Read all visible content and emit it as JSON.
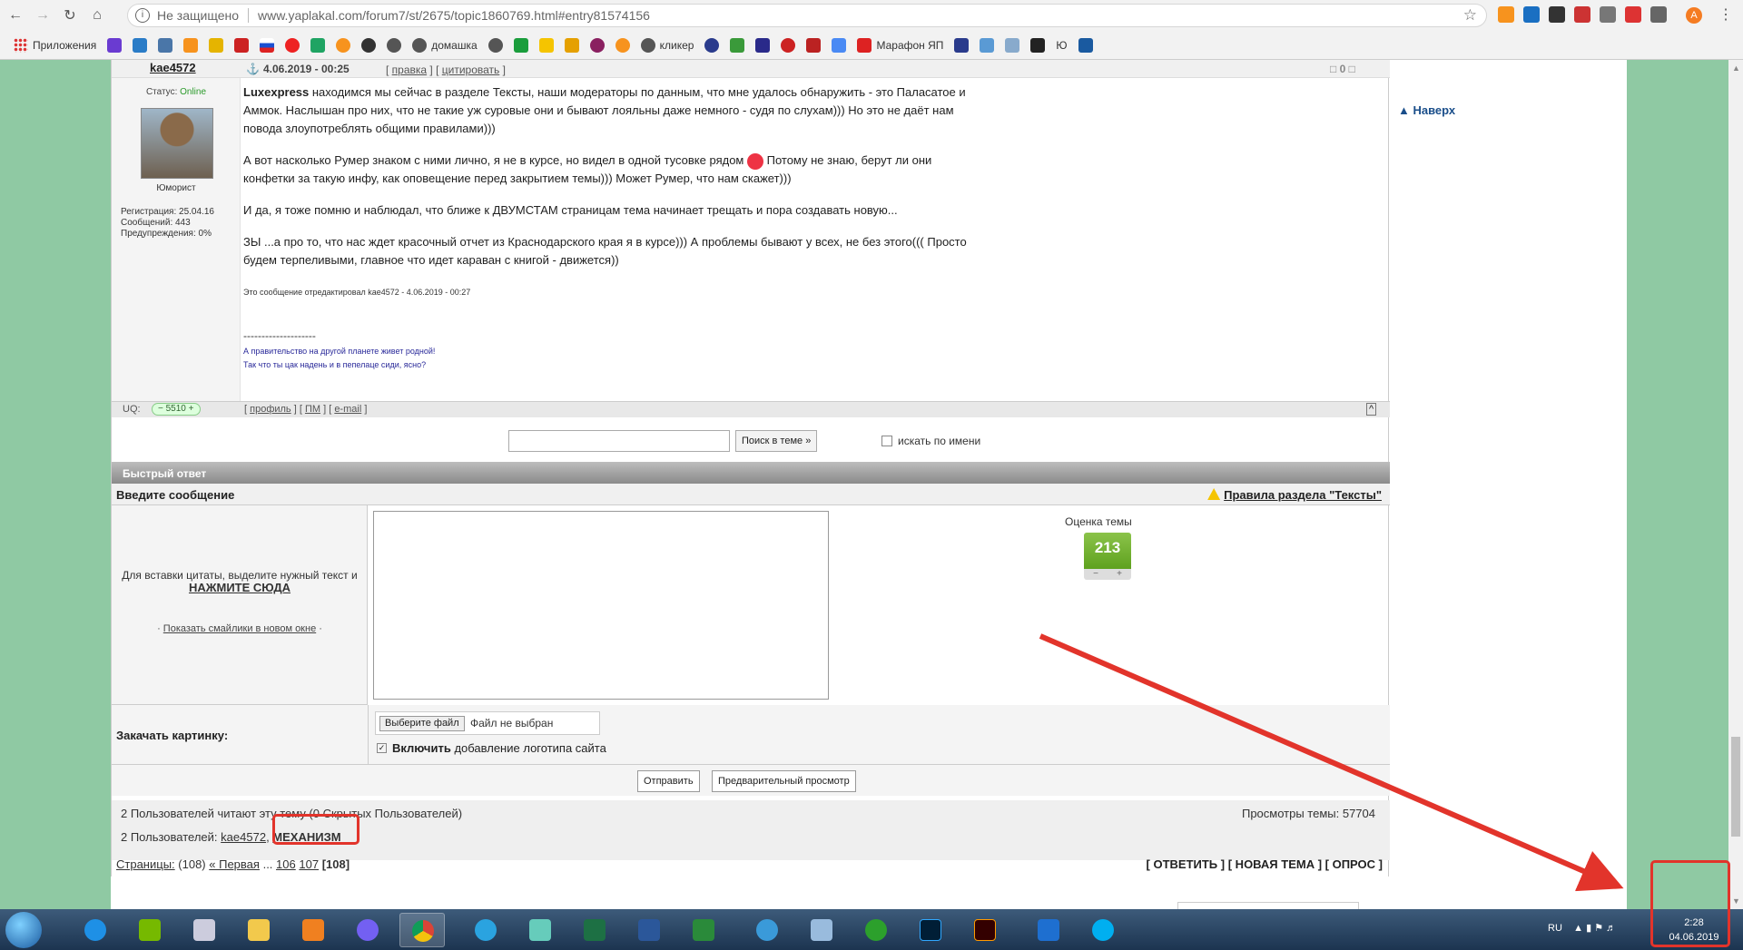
{
  "browser": {
    "insecure_label": "Не защищено",
    "url": "www.yaplakal.com/forum7/st/2675/topic1860769.html#entry81574156",
    "profile_letter": "A"
  },
  "bookmarks": [
    {
      "label": "Приложения"
    },
    {
      "label": ""
    },
    {
      "label": ""
    },
    {
      "label": ""
    },
    {
      "label": ""
    },
    {
      "label": ""
    },
    {
      "label": ""
    },
    {
      "label": ""
    },
    {
      "label": ""
    },
    {
      "label": ""
    },
    {
      "label": ""
    },
    {
      "label": ""
    },
    {
      "label": ""
    },
    {
      "label": "домашка"
    },
    {
      "label": ""
    },
    {
      "label": ""
    },
    {
      "label": ""
    },
    {
      "label": ""
    },
    {
      "label": ""
    },
    {
      "label": ""
    },
    {
      "label": "кликер"
    },
    {
      "label": ""
    },
    {
      "label": ""
    },
    {
      "label": ""
    },
    {
      "label": ""
    },
    {
      "label": ""
    },
    {
      "label": ""
    },
    {
      "label": "Марафон ЯП"
    },
    {
      "label": ""
    },
    {
      "label": ""
    },
    {
      "label": ""
    },
    {
      "label": ""
    },
    {
      "label": "Ю"
    },
    {
      "label": ""
    }
  ],
  "sidebar_right": {
    "up_link": "▲ Наверх"
  },
  "post": {
    "author": "kae4572",
    "date": "4.06.2019 - 00:25",
    "edit_label": "правка",
    "quote_label": "цитировать",
    "karma": "0",
    "status_label": "Статус:",
    "status_value": "Online",
    "rank": "Юморист",
    "registration": "Регистрация: 25.04.16",
    "messages": "Сообщений: 443",
    "warnings": "Предупреждения: 0%",
    "paragraph1_bold": "Luxexpress",
    "paragraph1": " находимся мы сейчас в разделе Тексты, наши модераторы по данным, что мне удалось обнаружить - это Паласатое и Аммок. Наслышан про них, что не такие уж суровые они и бывают лояльны даже немного - судя по слухам))) Но это не даёт нам повода злоупотреблять общими правилами)))",
    "paragraph2a": "А вот насколько Румер знаком с ними лично, я не в курсе, но видел в одной тусовке рядом ",
    "paragraph2b": " Потому не знаю, берут ли они конфетки за такую инфу, как оповещение перед закрытием темы))) Может Румер, что нам скажет)))",
    "paragraph3": "И да, я тоже помню и наблюдал, что ближе к ДВУМСТАМ страницам тема начинает трещать и пора создавать новую...",
    "paragraph4": "ЗЫ ...а про то, что нас ждет красочный отчет из Краснодарского края я в курсе))) А проблемы бывают у всех, не без этого((( Просто будем терпеливыми, главное что идет караван с книгой - движется))",
    "edited_note": "Это сообщение отредактировал kae4572 - 4.06.2019 - 00:27",
    "sig_dashes": "--------------------",
    "sig_line1": "А правительство на другой планете живет родной!",
    "sig_line2": "Так что ты цак надень и в пепелаце сиди, ясно?",
    "uq_label": "UQ:",
    "uq_value": "5510",
    "profile_link": "профиль",
    "pm_link": "ПМ",
    "email_link": "e-mail",
    "top_link": "^"
  },
  "search": {
    "button": "Поиск в теме »",
    "by_name": "искать по имени"
  },
  "quick_reply": {
    "header": "Быстрый ответ",
    "enter_message": "Введите сообщение",
    "rules": "Правила раздела \"Тексты\"",
    "hint": "Для вставки цитаты, выделите нужный текст и",
    "hint_click": "НАЖМИТЕ СЮДА",
    "smiles_link": "Показать смайлики в новом окне",
    "rating_title": "Оценка темы",
    "rating_value": "213",
    "rating_minus": "−",
    "rating_plus": "+",
    "upload_label": "Закачать картинку:",
    "choose_file": "Выберите файл",
    "no_file": "Файл не выбран",
    "logo_bold": "Включить",
    "logo_rest": " добавление логотипа сайта",
    "send": "Отправить",
    "preview": "Предварительный просмотр"
  },
  "readers": {
    "line1": "2 Пользователей читают эту тему (0 Скрытых Пользователей)",
    "views": "Просмотры темы: 57704",
    "line2_prefix": "2 Пользователей:",
    "user1": "kae4572",
    "user2": "МЕХАНИЗМ"
  },
  "pages": {
    "label": "Страницы:",
    "count": "(108)",
    "first": "« Первая",
    "dots": "...",
    "p106": "106",
    "p107": "107",
    "current": "[108]",
    "reply": "[ ОТВЕТИТЬ ]",
    "new_topic": "[ НОВАЯ ТЕМА ]",
    "poll": "[ ОПРОС ]"
  },
  "taskbar": {
    "lang": "RU",
    "time": "2:28",
    "date": "04.06.2019"
  },
  "colors": {
    "side": "#8fc9a3",
    "annotation": "#e2342b"
  }
}
